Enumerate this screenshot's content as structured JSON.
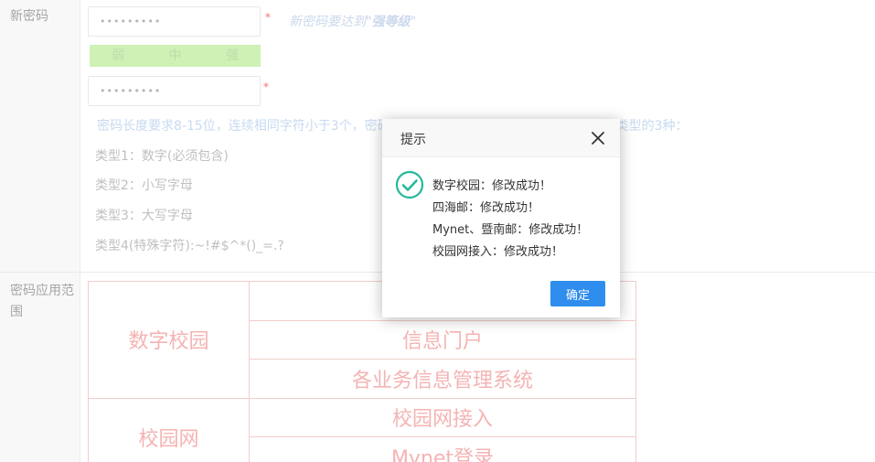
{
  "form": {
    "new_password_label": "新密码",
    "password_mask": "•••••••••",
    "confirm_mask": "•••••••••",
    "required_mark": "*",
    "hint_prefix": "新密码要达到\"",
    "hint_strong": "强等级",
    "hint_suffix": "\"",
    "strength": {
      "weak": "弱",
      "medium": "中",
      "strong": "强"
    },
    "rule_text": "密码长度要求8-15位，连续相同字符小于3个，密码必须包含以下字符类型中的任意3种字符类型的3种：",
    "types": [
      "类型1：数字(必须包含)",
      "类型2：小写字母",
      "类型3：大写字母",
      "类型4(特殊字符):~!#$^*()_=.?"
    ],
    "scope_label": "密码应用范围"
  },
  "apps_table": {
    "groups": [
      {
        "name": "数字校园",
        "systems": [
          "",
          "信息门户",
          "各业务信息管理系统"
        ]
      },
      {
        "name": "校园网",
        "systems": [
          "校园网接入",
          "Mynet登录"
        ]
      }
    ]
  },
  "dialog": {
    "title": "提示",
    "messages": [
      "数字校园：修改成功！",
      "四海邮：修改成功！",
      "Mynet、暨南邮：修改成功！",
      "校园网接入：修改成功！"
    ],
    "confirm_label": "确定"
  },
  "colors": {
    "accent": "#2e8ded",
    "success": "#26b99a",
    "table_border": "#f1c5c5",
    "table_text": "#f4a9a9",
    "strength_bar": "#c8efac"
  }
}
